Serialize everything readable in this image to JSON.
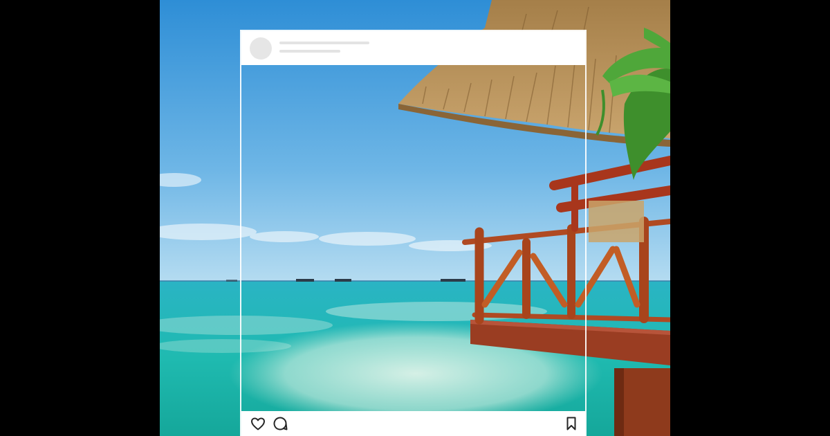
{
  "scene": {
    "description_icons": [
      "heart-icon",
      "comment-icon",
      "bookmark-icon"
    ],
    "colors": {
      "sky_top": "#2f8fd6",
      "sky_bottom": "#9fd0ee",
      "sea": "#1fb6b0",
      "thatch": "#b9925a",
      "wood": "#9c3b22",
      "leaf": "#3f9b2a",
      "frame_white": "#ffffff"
    }
  },
  "post": {
    "icons": {
      "like": "heart-icon",
      "comment": "comment-icon",
      "save": "bookmark-icon"
    }
  }
}
